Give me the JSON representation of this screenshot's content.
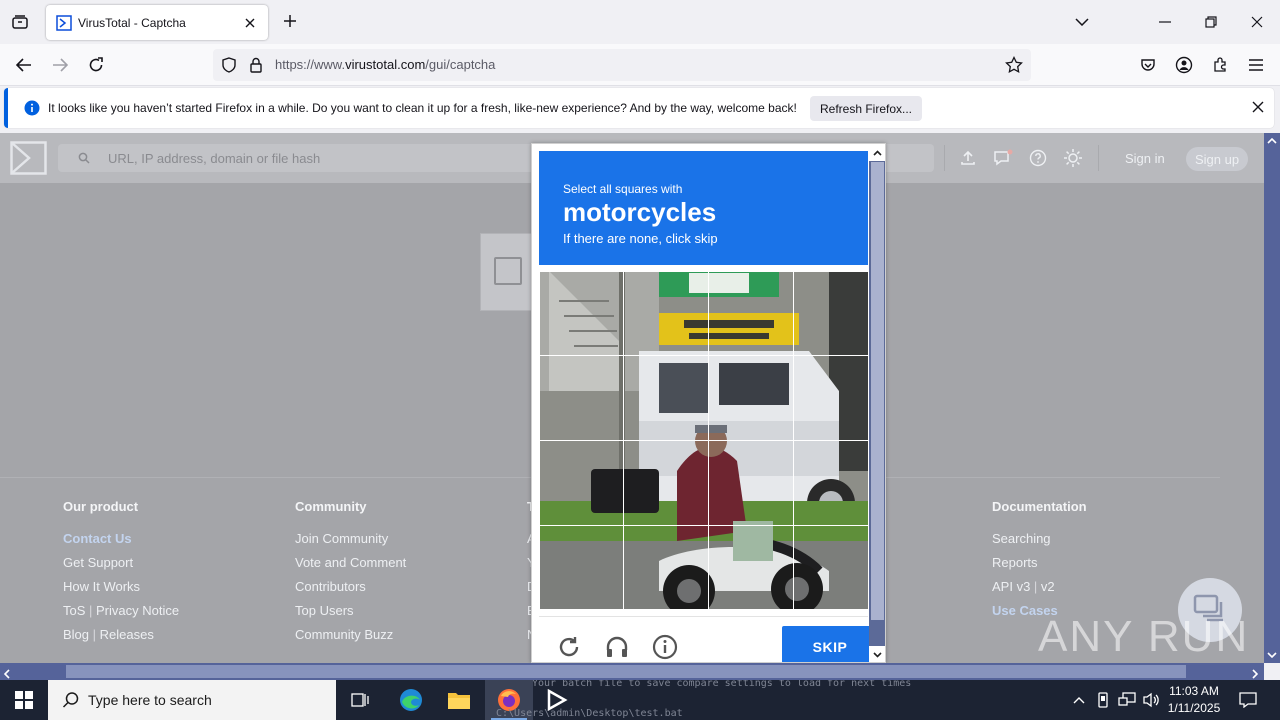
{
  "browser": {
    "tab_title": "VirusTotal - Captcha",
    "url_prefix": "https://www.",
    "url_host": "virustotal.com",
    "url_path": "/gui/captcha"
  },
  "notification": {
    "message": "It looks like you haven’t started Firefox in a while. Do you want to clean it up for a fresh, like-new experience? And by the way, welcome back!",
    "button_label": "Refresh Firefox..."
  },
  "vt": {
    "search_placeholder": "URL, IP address, domain or file hash",
    "sign_in": "Sign in",
    "sign_up": "Sign up"
  },
  "footer": {
    "our_product": {
      "heading": "Our product",
      "items": [
        "Contact Us",
        "Get Support",
        "How It Works",
        "ToS",
        "Privacy Notice",
        "Blog",
        "Releases"
      ]
    },
    "community": {
      "heading": "Community",
      "items": [
        "Join Community",
        "Vote and Comment",
        "Contributors",
        "Top Users",
        "Community Buzz"
      ]
    },
    "tools_partial": [
      "T",
      "A",
      "Y",
      "D",
      "E",
      "N"
    ],
    "documentation": {
      "heading": "Documentation",
      "items": [
        "Searching",
        "Reports",
        "API v3",
        "v2",
        "Use Cases"
      ]
    }
  },
  "captcha": {
    "instruction": "Select all squares with",
    "object": "motorcycles",
    "hint": "If there are none, click skip",
    "skip_label": "SKIP"
  },
  "watermark": "ANY RUN",
  "taskbar": {
    "search_placeholder": "Type here to search",
    "console_line1": "Your batch file to save compare settings to load for next times",
    "console_line2": "C:\\Users\\admin\\Desktop\\test.bat",
    "time": "11:03 AM",
    "date": "1/11/2025"
  }
}
